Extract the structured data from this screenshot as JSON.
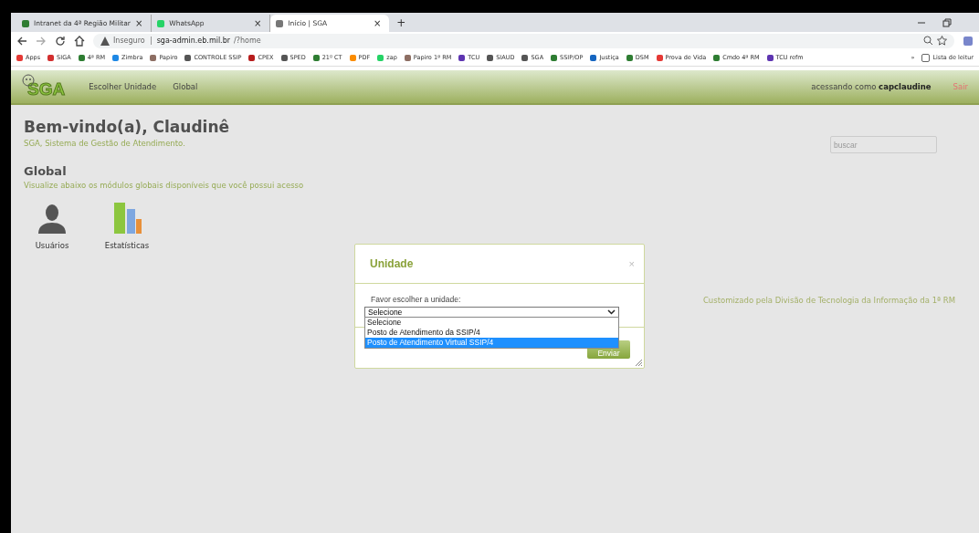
{
  "browser": {
    "tabs": [
      {
        "title": "Intranet da 4ª Região Militar",
        "close": "×",
        "selected": false,
        "color": "#2e7d32"
      },
      {
        "title": "WhatsApp",
        "close": "×",
        "selected": false,
        "color": "#25d366"
      },
      {
        "title": "Início | SGA",
        "close": "×",
        "selected": true,
        "color": "#777777"
      }
    ],
    "new_tab": "+",
    "security": "Inseguro",
    "url_host": "sga-admin.eb.mil.br",
    "url_path": "/?home",
    "bookmarks": [
      {
        "label": "Apps",
        "color": "#e53935"
      },
      {
        "label": "SIGA",
        "color": "#d32f2f"
      },
      {
        "label": "4ª RM",
        "color": "#2e7d32"
      },
      {
        "label": "Zimbra",
        "color": "#1e88e5"
      },
      {
        "label": "Papiro",
        "color": "#8d6e63"
      },
      {
        "label": "CONTROLE SSIP",
        "color": "#555555"
      },
      {
        "label": "CPEX",
        "color": "#b71c1c"
      },
      {
        "label": "SPED",
        "color": "#555555"
      },
      {
        "label": "21º CT",
        "color": "#2e7d32"
      },
      {
        "label": "PDF",
        "color": "#fb8c00"
      },
      {
        "label": "zap",
        "color": "#25d366"
      },
      {
        "label": "Papiro 1ª RM",
        "color": "#8d6e63"
      },
      {
        "label": "TCU",
        "color": "#5e35b1"
      },
      {
        "label": "SIAUD",
        "color": "#555555"
      },
      {
        "label": "SGA",
        "color": "#555555"
      },
      {
        "label": "SSIP/OP",
        "color": "#2e7d32"
      },
      {
        "label": "Justiça",
        "color": "#1565c0"
      },
      {
        "label": "DSM",
        "color": "#2e7d32"
      },
      {
        "label": "Prova de Vida",
        "color": "#e53935"
      },
      {
        "label": "Cmdo 4ª RM",
        "color": "#2e7d32"
      },
      {
        "label": "TCU refm",
        "color": "#5e35b1"
      }
    ],
    "more": "»",
    "reading_list": "Lista de leitur"
  },
  "header": {
    "logo": "SGA",
    "nav": [
      {
        "label": "Escolher Unidade"
      },
      {
        "label": "Global"
      }
    ],
    "user_prefix": "acessando como",
    "user": "capclaudine",
    "logout": "Sair"
  },
  "page": {
    "title": "Bem-vindo(a), Claudinê",
    "subtitle": "SGA, Sistema de Gestão de Atendimento.",
    "search": {
      "placeholder": "buscar"
    },
    "section_title": "Global",
    "section_subtitle": "Visualize abaixo os módulos globais disponíveis que você possui acesso",
    "modules": [
      {
        "label": "Usuários",
        "kind": "users"
      },
      {
        "label": "Estatísticas",
        "kind": "stats"
      }
    ],
    "footer": "Customizado pela Divisão de Tecnologia da Informação da 1ª RM"
  },
  "dialog": {
    "title": "Unidade",
    "close": "×",
    "label": "Favor escolher a unidade:",
    "select_value": "Selecione",
    "options": [
      {
        "label": "Selecione",
        "selected": false
      },
      {
        "label": "Posto de Atendimento da SSIP/4",
        "selected": false
      },
      {
        "label": "Posto de Atendimento Virtual SSIP/4",
        "selected": true
      }
    ],
    "submit": "Enviar"
  }
}
